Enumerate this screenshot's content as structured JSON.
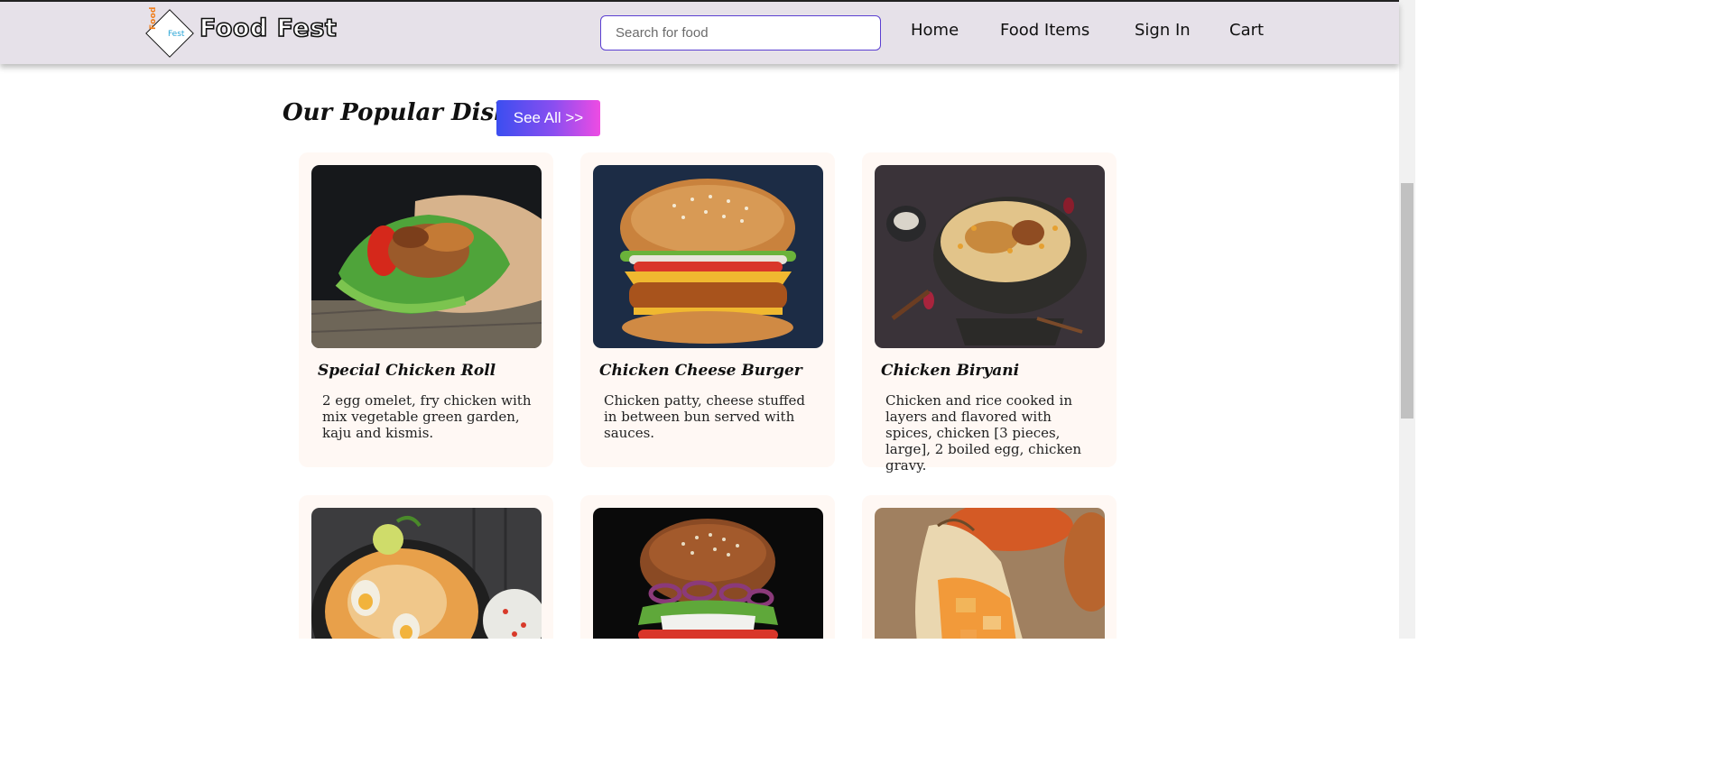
{
  "navbar": {
    "logo": {
      "word1": "Food",
      "word2": "Fest"
    },
    "brand": "Food Fest",
    "search": {
      "placeholder": "Search for food",
      "value": ""
    },
    "links": [
      "Home",
      "Food Items",
      "Sign In",
      "Cart"
    ]
  },
  "section": {
    "title": "Our Popular Dishes",
    "see_all": "See All >>"
  },
  "dishes": [
    {
      "name": "Special Chicken Roll",
      "description": "2 egg omelet, fry chicken with mix vegetable green garden, kaju and kismis.",
      "image": "chicken-roll-photo"
    },
    {
      "name": "Chicken Cheese Burger",
      "description": "Chicken patty, cheese stuffed in between bun served with sauces.",
      "image": "cheese-burger-photo"
    },
    {
      "name": "Chicken Biryani",
      "description": "Chicken and rice cooked in layers and flavored with spices, chicken [3 pieces, large], 2 boiled egg, chicken gravy.",
      "image": "biryani-photo"
    },
    {
      "name": "",
      "description": "",
      "image": "egg-biryani-photo"
    },
    {
      "name": "",
      "description": "",
      "image": "burger-photo"
    },
    {
      "name": "",
      "description": "",
      "image": "wrap-photo"
    }
  ],
  "colors": {
    "navbar_bg": "#e6e1e9",
    "card_bg": "#fff8f4",
    "search_border": "#5b3fd1",
    "button_gradient_start": "#3b4ef0",
    "button_gradient_end": "#ee4ce3"
  }
}
